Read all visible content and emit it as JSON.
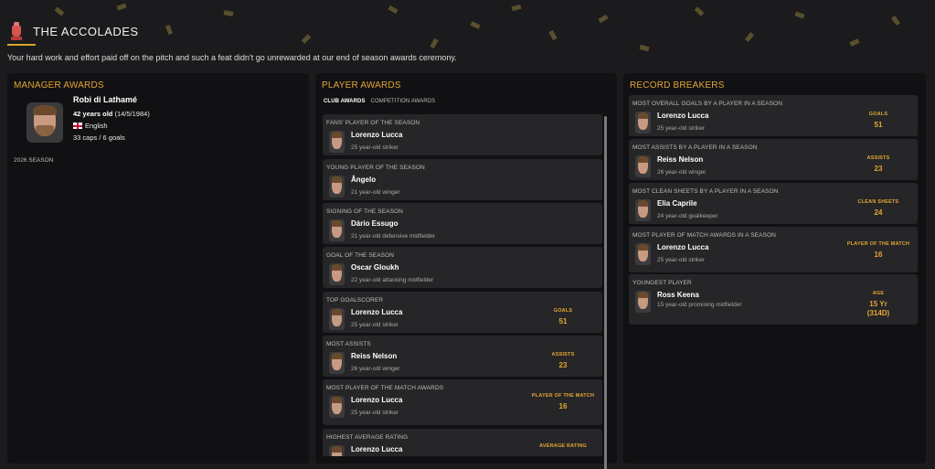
{
  "header": {
    "title": "THE ACCOLADES",
    "subtitle": "Your hard work and effort paid off on the pitch and such a feat didn't go unrewarded at our end of season awards ceremony."
  },
  "manager_awards": {
    "title": "MANAGER AWARDS",
    "name": "Robi di Lathamé",
    "age": "42 years old",
    "dob": "(14/5/1984)",
    "nationality": "English",
    "caps": "33 caps / 6 goals",
    "season": "2026 SEASON"
  },
  "player_awards": {
    "title": "PLAYER AWARDS",
    "tabs": [
      {
        "label": "CLUB AWARDS",
        "active": true
      },
      {
        "label": "COMPETITION AWARDS",
        "active": false
      }
    ],
    "items": [
      {
        "award": "FANS' PLAYER OF THE SEASON",
        "player": "Lorenzo Lucca",
        "desc": "25 year-old striker",
        "stat_label": "",
        "stat_value": ""
      },
      {
        "award": "YOUNG PLAYER OF THE SEASON",
        "player": "Ângelo",
        "desc": "21 year-old winger",
        "stat_label": "",
        "stat_value": ""
      },
      {
        "award": "SIGNING OF THE SEASON",
        "player": "Dário Essugo",
        "desc": "21 year-old defensive midfielder",
        "stat_label": "",
        "stat_value": ""
      },
      {
        "award": "GOAL OF THE SEASON",
        "player": "Oscar Gloukh",
        "desc": "22 year-old attacking midfielder",
        "stat_label": "",
        "stat_value": ""
      },
      {
        "award": "TOP GOALSCORER",
        "player": "Lorenzo Lucca",
        "desc": "25 year-old striker",
        "stat_label": "GOALS",
        "stat_value": "51"
      },
      {
        "award": "MOST ASSISTS",
        "player": "Reiss Nelson",
        "desc": "26 year-old winger",
        "stat_label": "ASSISTS",
        "stat_value": "23"
      },
      {
        "award": "MOST PLAYER OF THE MATCH AWARDS",
        "player": "Lorenzo Lucca",
        "desc": "25 year-old striker",
        "stat_label": "PLAYER OF THE MATCH",
        "stat_value": "16"
      },
      {
        "award": "HIGHEST AVERAGE RATING",
        "player": "Lorenzo Lucca",
        "desc": "",
        "stat_label": "AVERAGE RATING",
        "stat_value": ""
      }
    ]
  },
  "record_breakers": {
    "title": "RECORD BREAKERS",
    "items": [
      {
        "record": "MOST OVERALL GOALS BY A PLAYER IN A SEASON",
        "player": "Lorenzo Lucca",
        "desc": "25 year-old striker",
        "stat_label": "GOALS",
        "stat_value": "51"
      },
      {
        "record": "MOST ASSISTS BY A PLAYER IN A SEASON",
        "player": "Reiss Nelson",
        "desc": "26 year-old winger",
        "stat_label": "ASSISTS",
        "stat_value": "23"
      },
      {
        "record": "MOST CLEAN SHEETS BY A PLAYER IN A SEASON",
        "player": "Elia Caprile",
        "desc": "24 year-old goalkeeper",
        "stat_label": "CLEAN SHEETS",
        "stat_value": "24"
      },
      {
        "record": "MOST PLAYER OF MATCH AWARDS IN A SEASON",
        "player": "Lorenzo Lucca",
        "desc": "25 year-old striker",
        "stat_label": "PLAYER OF THE MATCH",
        "stat_value": "16"
      },
      {
        "record": "YOUNGEST PLAYER",
        "player": "Ross Keena",
        "desc": "15 year-old promising midfielder",
        "stat_label": "AGE",
        "stat_value": "15 Yr",
        "stat_value_2": "(314D)"
      }
    ]
  },
  "colors": {
    "accent": "#e3a634",
    "background": "#1b1b1d",
    "panel": "#111113",
    "card": "#262628"
  }
}
